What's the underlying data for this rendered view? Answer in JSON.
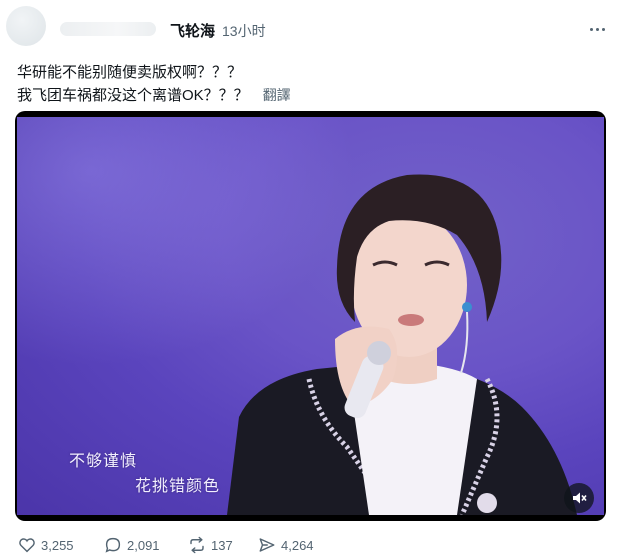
{
  "post": {
    "author_name": "飞轮海",
    "time": "13小时",
    "text_line1": "华研能不能别随便卖版权啊？？？",
    "text_line2": "我飞团车祸都没这个离谱OK？？？",
    "translate_label": "翻譯"
  },
  "video": {
    "caption_line1": "不够谨慎",
    "caption_line2": "花挑错颜色"
  },
  "actions": {
    "likes": "3,255",
    "replies": "2,091",
    "reposts": "137",
    "shares": "4,264"
  },
  "icons": {
    "more": "more-icon",
    "mute": "speaker-muted-icon",
    "like": "heart-icon",
    "reply": "comment-icon",
    "repost": "repost-icon",
    "share": "send-icon"
  }
}
